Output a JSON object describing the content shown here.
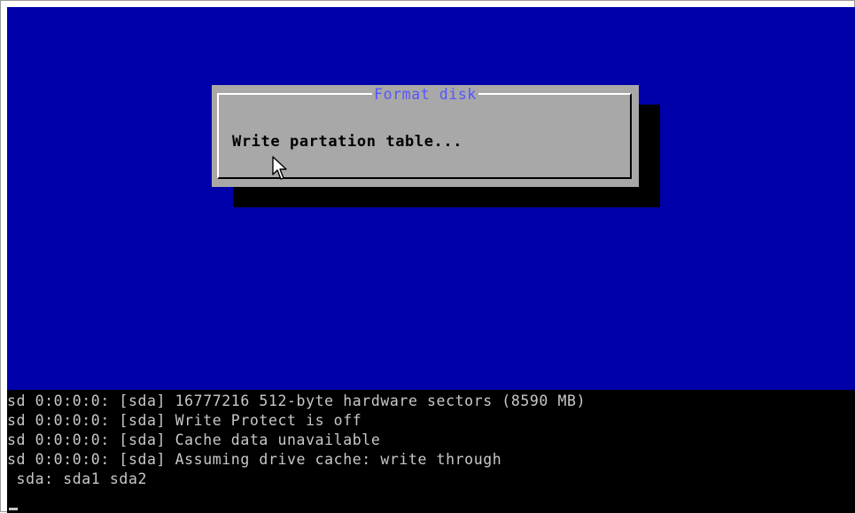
{
  "dialog": {
    "title": "Format disk",
    "message": "Write partation table..."
  },
  "console": {
    "lines": [
      "sd 0:0:0:0: [sda] 16777216 512-byte hardware sectors (8590 MB)",
      "sd 0:0:0:0: [sda] Write Protect is off",
      "sd 0:0:0:0: [sda] Cache data unavailable",
      "sd 0:0:0:0: [sda] Assuming drive cache: write through",
      " sda: sda1 sda2"
    ]
  },
  "colors": {
    "screen_background": "#0000aa",
    "dialog_background": "#a8a8a8",
    "dialog_title": "#5555ff",
    "console_background": "#000000",
    "console_text": "#c8c8c8"
  },
  "icons": {
    "pointer": "mouse-pointer-icon"
  }
}
